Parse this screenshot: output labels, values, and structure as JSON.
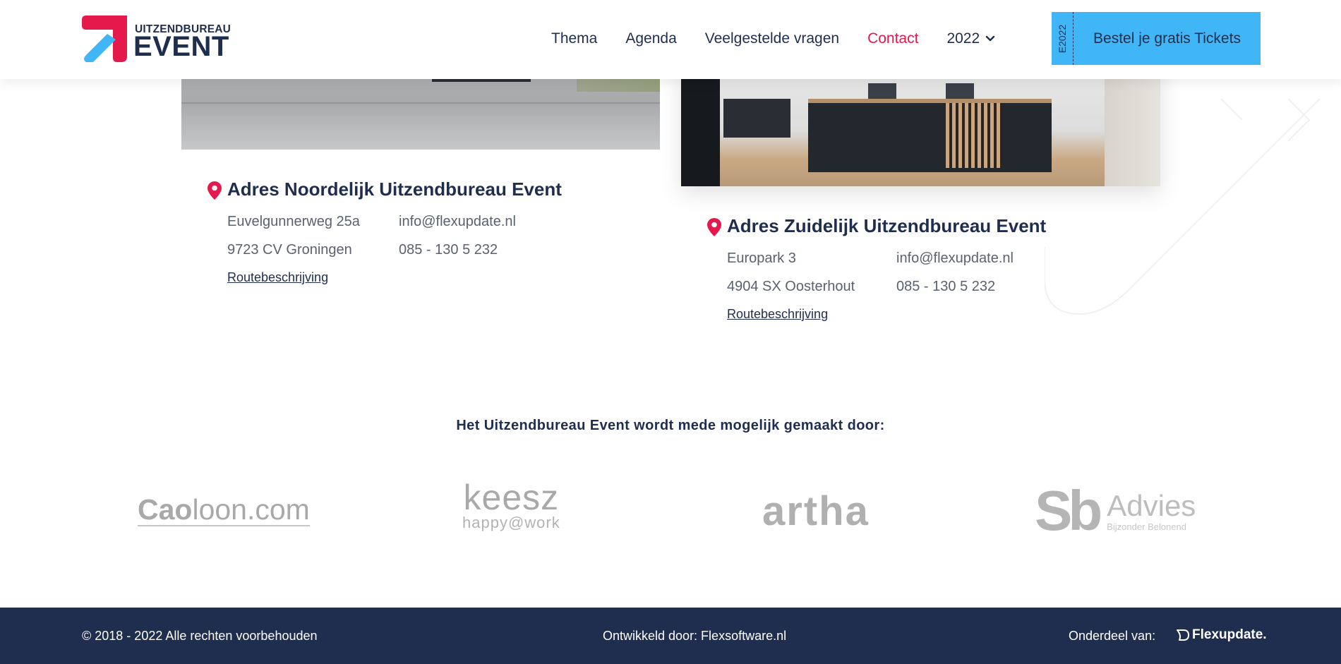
{
  "header": {
    "logo_top": "UITZENDBUREAU",
    "logo_bottom": "EVENT",
    "nav": [
      {
        "label": "Thema"
      },
      {
        "label": "Agenda"
      },
      {
        "label": "Veelgestelde vragen"
      },
      {
        "label": "Contact",
        "active": true
      }
    ],
    "year": "2022",
    "ticket_stub": "E2022",
    "ticket_label": "Bestel je gratis Tickets"
  },
  "locations": {
    "north": {
      "title": "Adres Noordelijk Uitzendbureau Event",
      "street": "Euvelgunnerweg 25a",
      "city": "9723 CV Groningen",
      "email": "info@flexupdate.nl",
      "phone": "085 - 130 5 232",
      "route": "Routebeschrijving"
    },
    "south": {
      "title": "Adres Zuidelijk Uitzendbureau Event",
      "street": "Europark 3",
      "city": "4904 SX Oosterhout",
      "email": "info@flexupdate.nl",
      "phone": "085 - 130 5 232",
      "route": "Routebeschrijving"
    }
  },
  "sponsors": {
    "heading": "Het Uitzendbureau Event wordt mede mogelijk gemaakt door:",
    "caoloon_bold": "Cao",
    "caoloon_rest": "loon.com",
    "keesz_name": "keesz",
    "keesz_tagline": "happy@work",
    "artha": "artha",
    "sub_mark": "Sb",
    "sub_name": "Advies",
    "sub_tagline": "Bijzonder Belonend"
  },
  "footer": {
    "copyright": "© 2018 - 2022 Alle rechten voorbehouden",
    "developed": "Ontwikkeld door: Flexsoftware.nl",
    "part_of": "Onderdeel van:",
    "brand": "Flexupdate."
  },
  "colors": {
    "navy": "#1f2d4f",
    "accent_red": "#e5194c",
    "ticket_blue": "#41b6f7",
    "logo_blue": "#41b6f7"
  },
  "icons": [
    "location-pin-icon",
    "chevron-down-icon",
    "flexupdate-logo-icon"
  ]
}
